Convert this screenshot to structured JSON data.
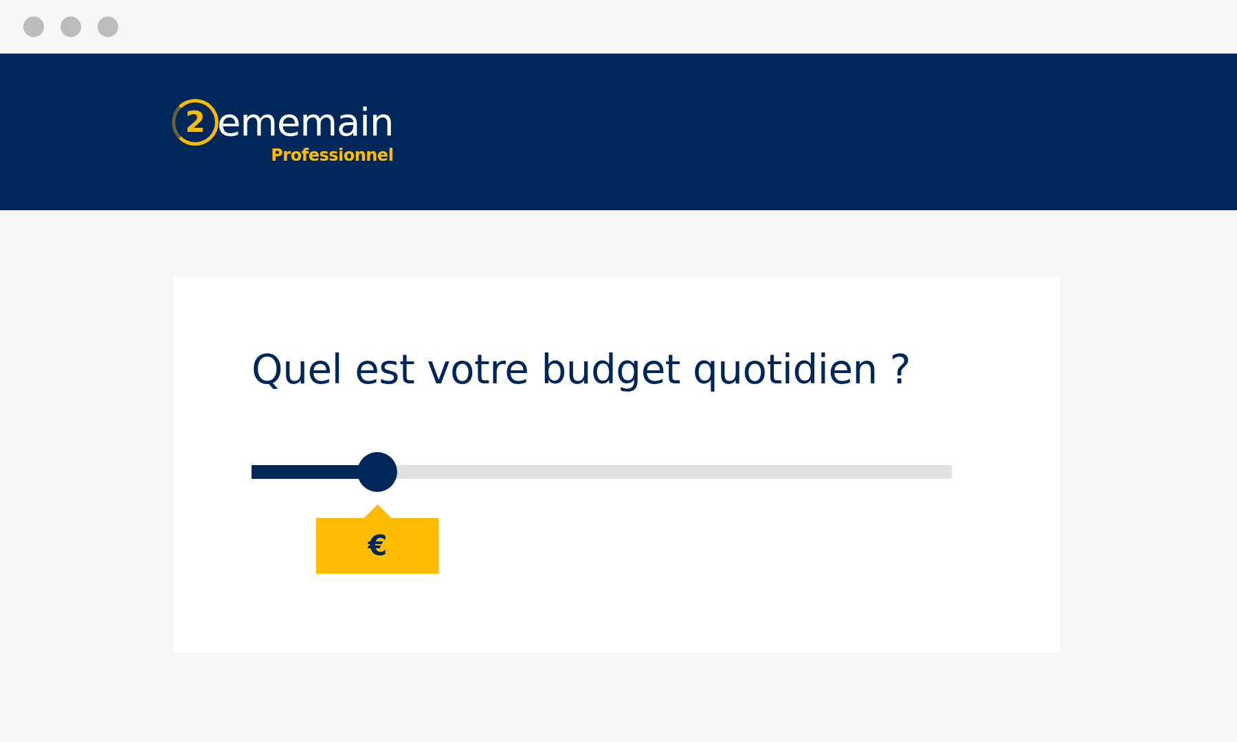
{
  "logo": {
    "badge": "2",
    "wordmark": "ememain",
    "tagline": "Professionnel"
  },
  "question": {
    "title": "Quel est votre budget quotidien ?"
  },
  "slider": {
    "level": 0.18,
    "tooltip": "€"
  }
}
